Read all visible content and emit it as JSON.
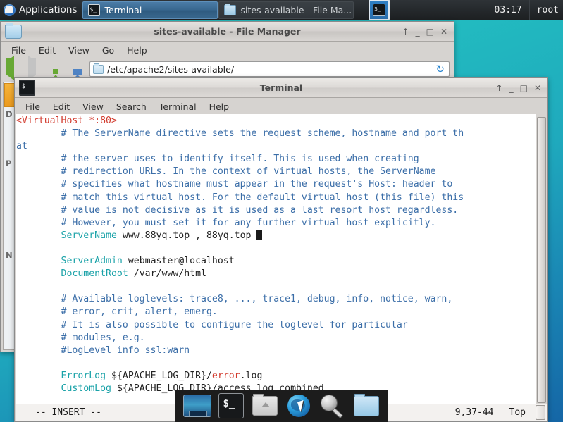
{
  "panel": {
    "applications_label": "Applications",
    "apps_icon": "hand-logo-icon",
    "tasks": [
      {
        "icon": "terminal-icon",
        "label": "Terminal",
        "state": "active"
      },
      {
        "icon": "folder-icon",
        "label": "sites-available - File Ma...",
        "state": "inactive"
      }
    ],
    "tray_icon": "terminal-tray-icon",
    "clock": "03:17",
    "user": "root"
  },
  "file_manager": {
    "title": "sites-available - File Manager",
    "window_icon": "folder-icon",
    "window_buttons": {
      "shade": "↑",
      "minimize": "_",
      "maximize": "□",
      "close": "✕"
    },
    "menu": [
      "File",
      "Edit",
      "View",
      "Go",
      "Help"
    ],
    "toolbar": {
      "back_icon": "arrow-left-icon",
      "forward_icon": "arrow-right-icon",
      "up_icon": "arrow-up-icon",
      "home_icon": "home-icon",
      "reload_icon": "reload-icon",
      "reload_glyph": "↻",
      "path_icon": "folder-small-icon",
      "path_value": "/etc/apache2/sites-available/"
    },
    "sidebar_items": [
      "D",
      "P",
      "N"
    ]
  },
  "terminal": {
    "title": "Terminal",
    "window_icon": "terminal-icon",
    "window_buttons": {
      "shade": "↑",
      "minimize": "_",
      "maximize": "□",
      "close": "✕"
    },
    "menu": [
      "File",
      "Edit",
      "View",
      "Search",
      "Terminal",
      "Help"
    ],
    "lines": [
      [
        {
          "t": "<VirtualHost *:80>",
          "c": "tag"
        }
      ],
      [
        {
          "t": "        # The ServerName directive sets the request scheme, hostname and port th",
          "c": "cmt"
        }
      ],
      [
        {
          "t": "at",
          "c": "cmt"
        }
      ],
      [
        {
          "t": "        # the server uses to identify itself. This is used when creating",
          "c": "cmt"
        }
      ],
      [
        {
          "t": "        # redirection URLs. In the context of virtual hosts, the ServerName",
          "c": "cmt"
        }
      ],
      [
        {
          "t": "        # specifies what hostname must appear in the request's Host: header to",
          "c": "cmt"
        }
      ],
      [
        {
          "t": "        # match this virtual host. For the default virtual host (this file) this",
          "c": "cmt"
        }
      ],
      [
        {
          "t": "        # value is not decisive as it is used as a last resort host regardless.",
          "c": "cmt"
        }
      ],
      [
        {
          "t": "        # However, you must set it for any further virtual host explicitly.",
          "c": "cmt"
        }
      ],
      [
        {
          "t": "        ",
          "c": "cmt"
        },
        {
          "t": "ServerName",
          "c": "dir"
        },
        {
          "t": " www.88yq.top , 88yq.top ",
          "c": "plain"
        },
        {
          "t": "█",
          "c": "cursor"
        }
      ],
      [
        {
          "t": "",
          "c": "cmt"
        }
      ],
      [
        {
          "t": "        ",
          "c": "cmt"
        },
        {
          "t": "ServerAdmin",
          "c": "dir"
        },
        {
          "t": " webmaster@localhost",
          "c": "plain"
        }
      ],
      [
        {
          "t": "        ",
          "c": "cmt"
        },
        {
          "t": "DocumentRoot",
          "c": "dir"
        },
        {
          "t": " /var/www/html",
          "c": "plain"
        }
      ],
      [
        {
          "t": "",
          "c": "cmt"
        }
      ],
      [
        {
          "t": "        # Available loglevels: trace8, ..., trace1, debug, info, notice, warn,",
          "c": "cmt"
        }
      ],
      [
        {
          "t": "        # error, crit, alert, emerg.",
          "c": "cmt"
        }
      ],
      [
        {
          "t": "        # It is also possible to configure the loglevel for particular",
          "c": "cmt"
        }
      ],
      [
        {
          "t": "        # modules, e.g.",
          "c": "cmt"
        }
      ],
      [
        {
          "t": "        #LogLevel info ssl:warn",
          "c": "cmt"
        }
      ],
      [
        {
          "t": "",
          "c": "cmt"
        }
      ],
      [
        {
          "t": "        ",
          "c": "cmt"
        },
        {
          "t": "ErrorLog",
          "c": "dir"
        },
        {
          "t": " ${APACHE_LOG_DIR}/",
          "c": "plain"
        },
        {
          "t": "error",
          "c": "err"
        },
        {
          "t": ".log",
          "c": "plain"
        }
      ],
      [
        {
          "t": "        ",
          "c": "cmt"
        },
        {
          "t": "CustomLog",
          "c": "dir"
        },
        {
          "t": " ${APACHE_LOG_DIR}/access.log combined",
          "c": "plain"
        }
      ]
    ],
    "status": {
      "mode": "-- INSERT --",
      "position": "9,37-44",
      "scroll": "Top"
    }
  },
  "dock": {
    "items": [
      {
        "name": "display-icon",
        "label": "Display"
      },
      {
        "name": "terminal-icon",
        "label": "Terminal"
      },
      {
        "name": "home-folder-icon",
        "label": "Home"
      },
      {
        "name": "web-browser-icon",
        "label": "Web Browser"
      },
      {
        "name": "search-icon",
        "label": "Search"
      },
      {
        "name": "file-manager-icon",
        "label": "File Manager"
      }
    ]
  },
  "colors": {
    "desktop": "#1fbdc0",
    "panel": "#24282b",
    "accent_active_task": "#3a6991",
    "terminal_comment": "#3b6ea8",
    "terminal_directive": "#1aa2a8",
    "terminal_tag": "#d23b2e"
  }
}
